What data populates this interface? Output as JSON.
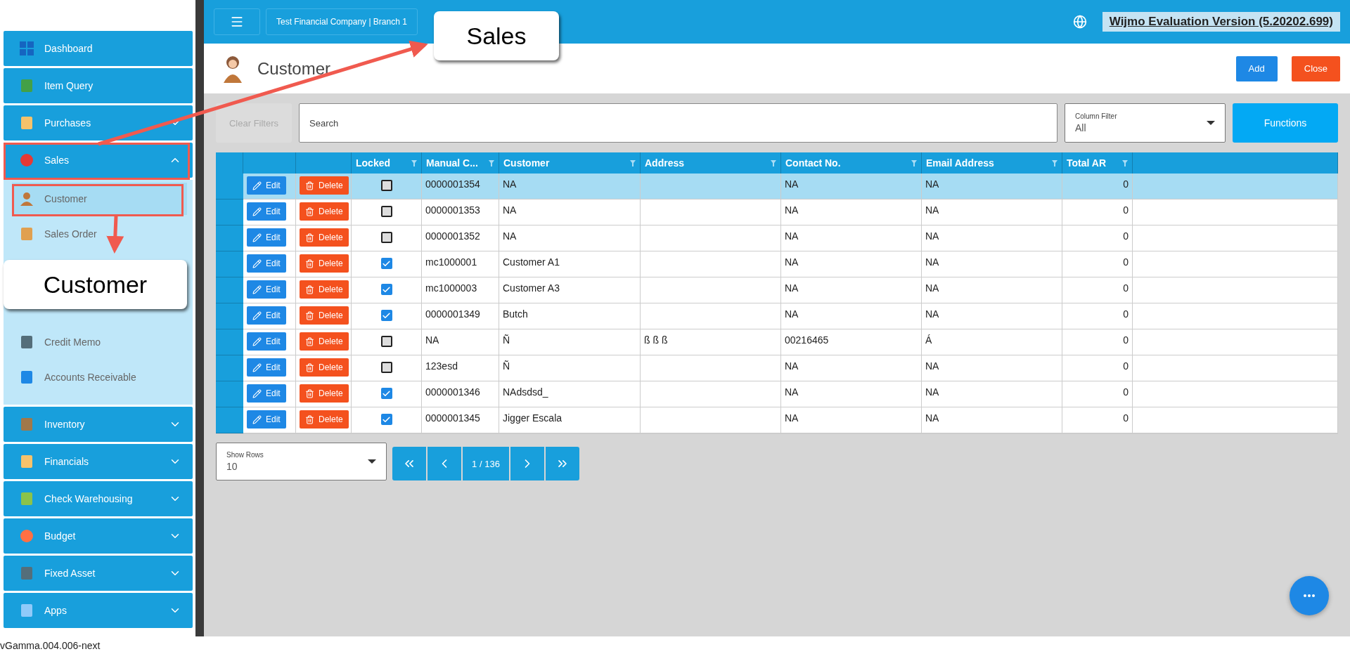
{
  "sidebar": {
    "items": [
      {
        "kind": "link",
        "label": "Dashboard"
      },
      {
        "kind": "link",
        "label": "Item Query"
      },
      {
        "kind": "group",
        "label": "Purchases",
        "expanded": false
      },
      {
        "kind": "group",
        "label": "Sales",
        "expanded": true,
        "children": [
          {
            "label": "Customer",
            "selected": true
          },
          {
            "label": "Sales Order",
            "selected": false
          },
          {
            "label": "Credit Memo",
            "selected": false
          },
          {
            "label": "Accounts Receivable",
            "selected": false
          }
        ]
      },
      {
        "kind": "group",
        "label": "Inventory",
        "expanded": false
      },
      {
        "kind": "group",
        "label": "Financials",
        "expanded": false
      },
      {
        "kind": "group",
        "label": "Check Warehousing",
        "expanded": false
      },
      {
        "kind": "group",
        "label": "Budget",
        "expanded": false
      },
      {
        "kind": "group",
        "label": "Fixed Asset",
        "expanded": false
      },
      {
        "kind": "group",
        "label": "Apps",
        "expanded": false
      }
    ]
  },
  "header": {
    "company": "Test Financial Company | Branch 1",
    "banner": "Wijmo Evaluation Version (5.20202.699)"
  },
  "page": {
    "title": "Customer",
    "buttons": [
      {
        "kind": "primary",
        "label": "Add"
      },
      {
        "kind": "danger",
        "label": "Close"
      }
    ]
  },
  "toolbar": {
    "clear_filters": {
      "label": "Clear Filters",
      "disabled": true
    },
    "search": {
      "placeholder": "Search"
    },
    "column_filter": {
      "label": "Column Filter",
      "value": "All"
    },
    "functions": "Functions"
  },
  "table": {
    "columns": [
      "Locked",
      "Manual C...",
      "Customer",
      "Address",
      "Contact No.",
      "Email Address",
      "Total AR"
    ],
    "rows": [
      {
        "edit": "Edit",
        "delete": "Delete",
        "selected": true,
        "locked": false,
        "manual": "0000001354",
        "customer": "NA",
        "address": "",
        "contact": "NA",
        "email": "NA",
        "total_ar": "0"
      },
      {
        "edit": "Edit",
        "delete": "Delete",
        "selected": false,
        "locked": false,
        "manual": "0000001353",
        "customer": "NA",
        "address": "",
        "contact": "NA",
        "email": "NA",
        "total_ar": "0"
      },
      {
        "edit": "Edit",
        "delete": "Delete",
        "selected": false,
        "locked": false,
        "manual": "0000001352",
        "customer": "NA",
        "address": "",
        "contact": "NA",
        "email": "NA",
        "total_ar": "0"
      },
      {
        "edit": "Edit",
        "delete": "Delete",
        "selected": false,
        "locked": true,
        "manual": "mc1000001",
        "customer": "Customer A1",
        "address": "",
        "contact": "NA",
        "email": "NA",
        "total_ar": "0"
      },
      {
        "edit": "Edit",
        "delete": "Delete",
        "selected": false,
        "locked": true,
        "manual": "mc1000003",
        "customer": "Customer A3",
        "address": "",
        "contact": "NA",
        "email": "NA",
        "total_ar": "0"
      },
      {
        "edit": "Edit",
        "delete": "Delete",
        "selected": false,
        "locked": true,
        "manual": "0000001349",
        "customer": "Butch",
        "address": "",
        "contact": "NA",
        "email": "NA",
        "total_ar": "0"
      },
      {
        "edit": "Edit",
        "delete": "Delete",
        "selected": false,
        "locked": false,
        "manual": "NA",
        "customer": "Ñ",
        "address": "ß ß ß",
        "contact": "00216465",
        "email": "Á",
        "total_ar": "0"
      },
      {
        "edit": "Edit",
        "delete": "Delete",
        "selected": false,
        "locked": false,
        "manual": "123esd",
        "customer": "Ñ",
        "address": "",
        "contact": "NA",
        "email": "NA",
        "total_ar": "0"
      },
      {
        "edit": "Edit",
        "delete": "Delete",
        "selected": false,
        "locked": true,
        "manual": "0000001346",
        "customer": "NAdsdsd_",
        "address": "",
        "contact": "NA",
        "email": "NA",
        "total_ar": "0"
      },
      {
        "edit": "Edit",
        "delete": "Delete",
        "selected": false,
        "locked": true,
        "manual": "0000001345",
        "customer": "Jigger Escala",
        "address": "",
        "contact": "NA",
        "email": "NA",
        "total_ar": "0"
      }
    ]
  },
  "pager": {
    "show_rows": {
      "label": "Show Rows",
      "value": "10"
    },
    "page": "1 / 136"
  },
  "footer": {
    "version": "vGamma.004.006-next"
  },
  "annotations": [
    {
      "text": "Sales"
    },
    {
      "text": "Customer"
    }
  ]
}
